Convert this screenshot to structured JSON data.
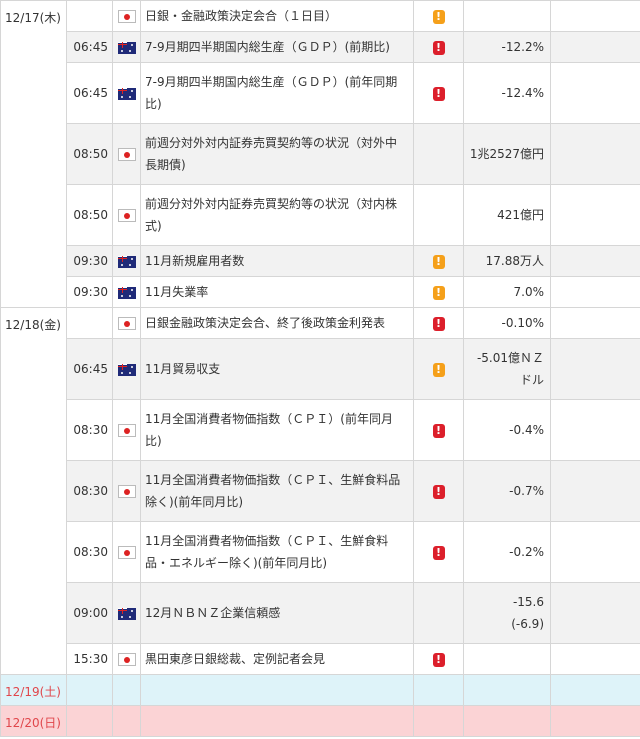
{
  "days": [
    {
      "date": "12/17(木)",
      "type": "weekday",
      "events": [
        {
          "time": "",
          "country": "JP",
          "lines": [
            "日銀・金融政策決定会合（１日目）"
          ],
          "importance": "mid",
          "forecast": [
            ""
          ]
        },
        {
          "time": "06:45",
          "country": "NZ",
          "lines": [
            "7-9月期四半期国内総生産（ＧＤＰ）(前期比)"
          ],
          "importance": "high",
          "forecast": [
            "-12.2%"
          ]
        },
        {
          "time": "06:45",
          "country": "NZ",
          "lines": [
            "7-9月期四半期国内総生産（ＧＤＰ）(前年同期",
            "比)"
          ],
          "importance": "high",
          "forecast": [
            "-12.4%"
          ]
        },
        {
          "time": "08:50",
          "country": "JP",
          "lines": [
            "前週分対外対内証券売買契約等の状況（対外中",
            "長期債)"
          ],
          "importance": "",
          "forecast": [
            "1兆2527億円"
          ]
        },
        {
          "time": "08:50",
          "country": "JP",
          "lines": [
            "前週分対外対内証券売買契約等の状況（対内株",
            "式)"
          ],
          "importance": "",
          "forecast": [
            "421億円"
          ]
        },
        {
          "time": "09:30",
          "country": "AU",
          "lines": [
            "11月新規雇用者数"
          ],
          "importance": "mid",
          "forecast": [
            "17.88万人"
          ]
        },
        {
          "time": "09:30",
          "country": "AU",
          "lines": [
            "11月失業率"
          ],
          "importance": "mid",
          "forecast": [
            "7.0%"
          ]
        }
      ]
    },
    {
      "date": "12/18(金)",
      "type": "weekday",
      "events": [
        {
          "time": "",
          "country": "JP",
          "lines": [
            "日銀金融政策決定会合、終了後政策金利発表"
          ],
          "importance": "high",
          "forecast": [
            "-0.10%"
          ]
        },
        {
          "time": "06:45",
          "country": "NZ",
          "lines": [
            "11月貿易収支"
          ],
          "importance": "mid",
          "forecast": [
            "-5.01億ＮＺ",
            "ドル"
          ]
        },
        {
          "time": "08:30",
          "country": "JP",
          "lines": [
            "11月全国消費者物価指数（ＣＰＩ）(前年同月",
            "比)"
          ],
          "importance": "high",
          "forecast": [
            "-0.4%"
          ]
        },
        {
          "time": "08:30",
          "country": "JP",
          "lines": [
            "11月全国消費者物価指数（ＣＰＩ、生鮮食料品",
            "除く)(前年同月比)"
          ],
          "importance": "high",
          "forecast": [
            "-0.7%"
          ]
        },
        {
          "time": "08:30",
          "country": "JP",
          "lines": [
            "11月全国消費者物価指数（ＣＰＩ、生鮮食料",
            "品・エネルギー除く)(前年同月比)"
          ],
          "importance": "high",
          "forecast": [
            "-0.2%"
          ]
        },
        {
          "time": "09:00",
          "country": "NZ",
          "lines": [
            "12月ＮＢＮＺ企業信頼感"
          ],
          "importance": "",
          "forecast": [
            "-15.6",
            "(-6.9)"
          ]
        },
        {
          "time": "15:30",
          "country": "JP",
          "lines": [
            "黒田東彦日銀総裁、定例記者会見"
          ],
          "importance": "high",
          "forecast": [
            ""
          ]
        }
      ]
    },
    {
      "date": "12/19(土)",
      "type": "sat",
      "events": []
    },
    {
      "date": "12/20(日)",
      "type": "sun",
      "events": []
    }
  ],
  "importance_glyph": "!",
  "colors": {
    "high": "#dc1f2b",
    "mid": "#f5a01a",
    "sat_bg": "#def3f9",
    "sun_bg": "#fbd3d5",
    "weekend_text": "#e0464b"
  }
}
